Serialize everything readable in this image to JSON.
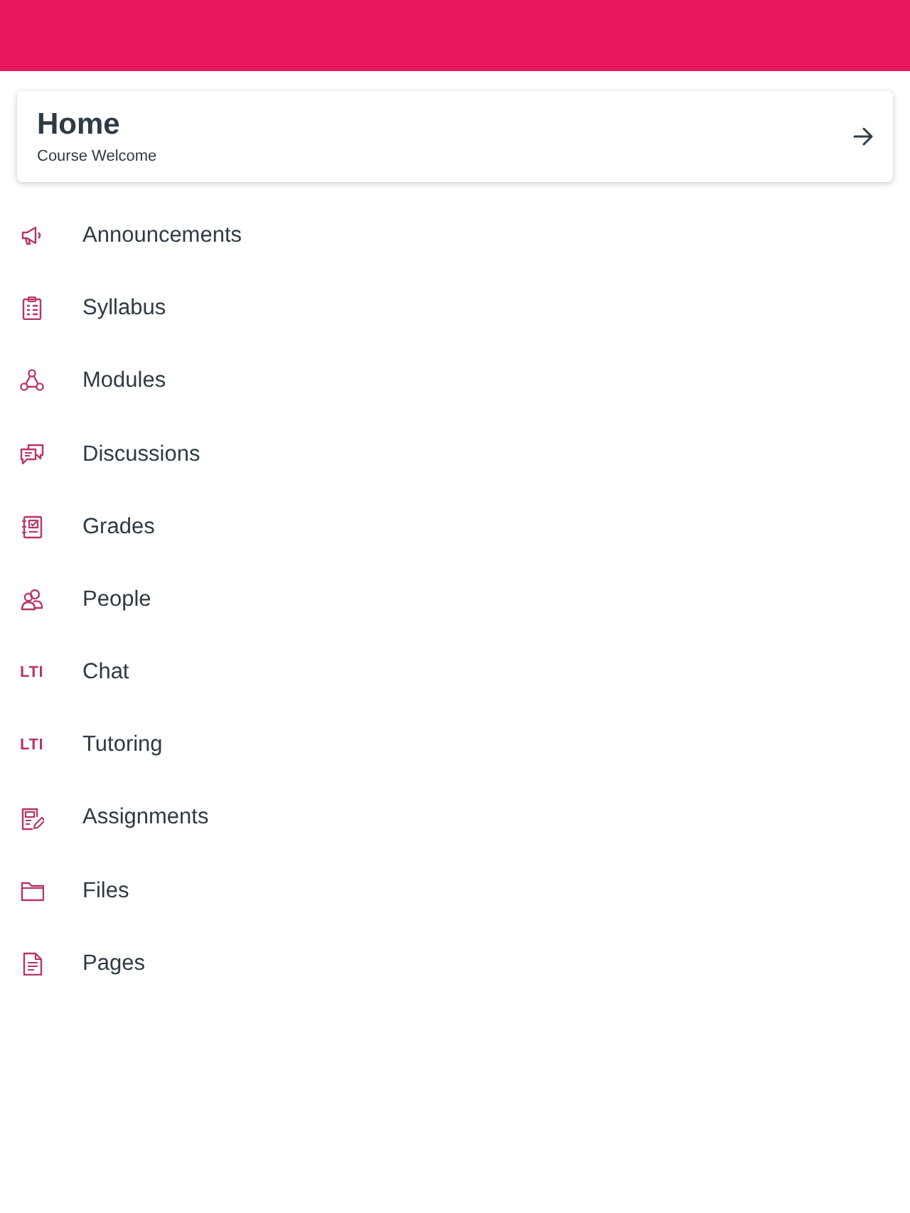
{
  "home_card": {
    "title": "Home",
    "subtitle": "Course Welcome"
  },
  "menu_items": [
    {
      "label": "Announcements",
      "kind": "icon"
    },
    {
      "label": "Syllabus",
      "kind": "icon"
    },
    {
      "label": "Modules",
      "kind": "icon"
    },
    {
      "label": "Discussions",
      "kind": "icon"
    },
    {
      "label": "Grades",
      "kind": "icon"
    },
    {
      "label": "People",
      "kind": "icon"
    },
    {
      "label": "Chat",
      "kind": "badge",
      "badge": "LTI"
    },
    {
      "label": "Tutoring",
      "kind": "badge",
      "badge": "LTI"
    },
    {
      "label": "Assignments",
      "kind": "icon"
    },
    {
      "label": "Files",
      "kind": "icon"
    },
    {
      "label": "Pages",
      "kind": "icon"
    }
  ]
}
